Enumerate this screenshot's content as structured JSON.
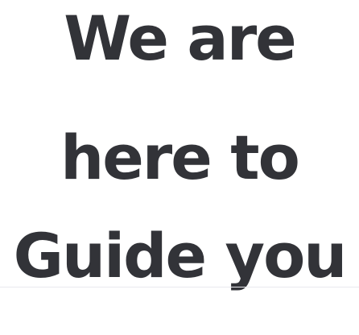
{
  "hero": {
    "heading_lines": [
      "We are",
      "here to",
      "Guide you"
    ]
  },
  "colors": {
    "text": "#323338",
    "background": "#ffffff",
    "divider": "#e9e9ee"
  }
}
